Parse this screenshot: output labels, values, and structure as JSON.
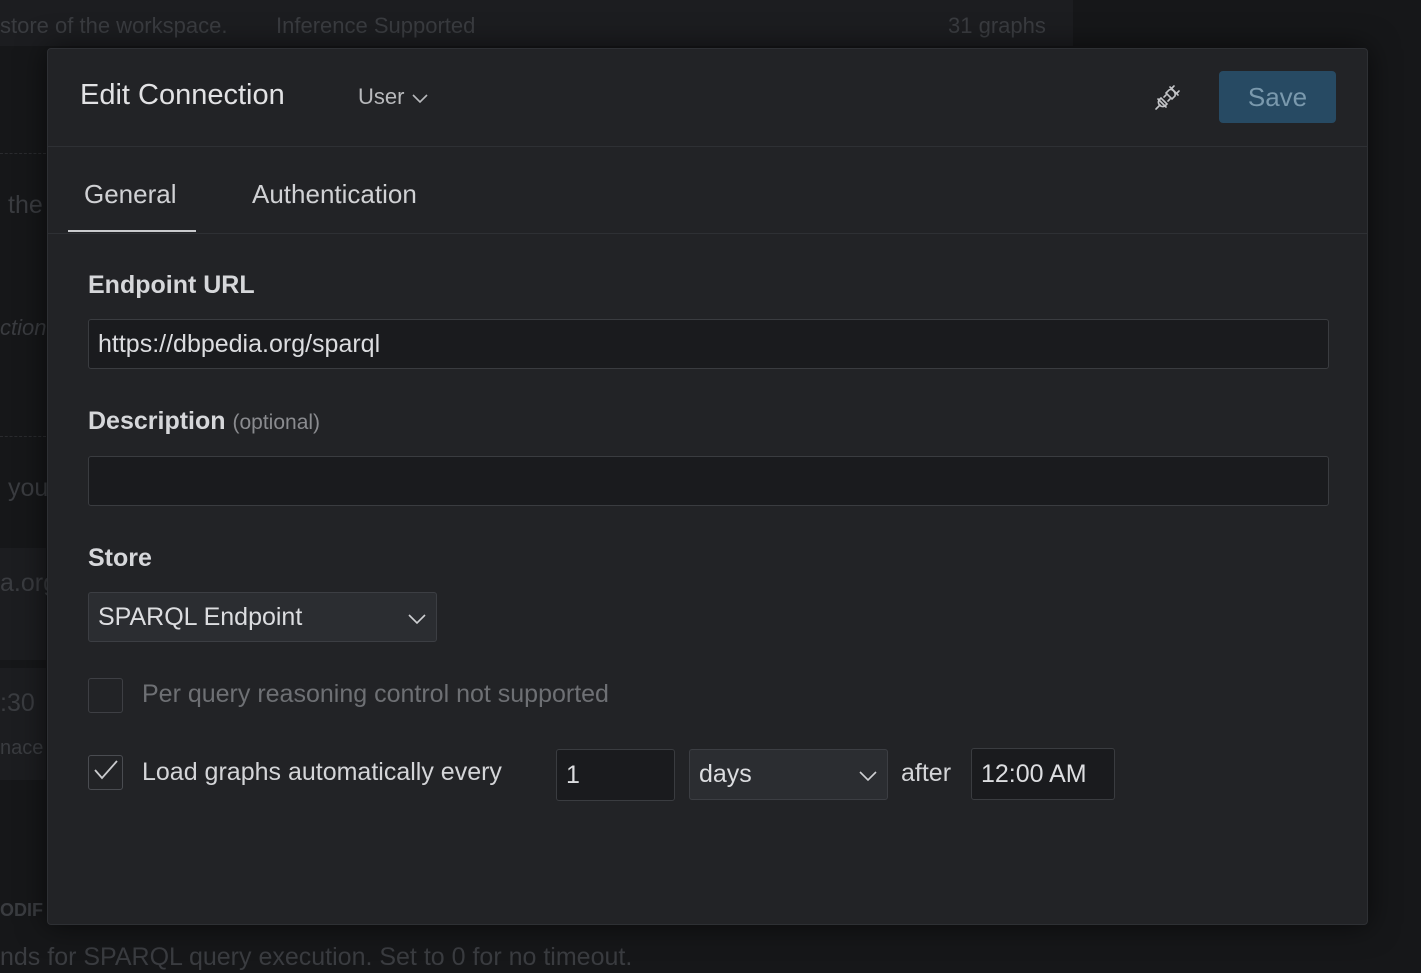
{
  "background": {
    "top_text": "store of the workspace.",
    "top_text2": "Inference Supported",
    "top_count": "31 graphs",
    "side_1": "the",
    "side_2": "ction",
    "side_3": "you",
    "side_4": "a.org",
    "side_5": ":30",
    "side_6": "nace",
    "side_7": "ODIF",
    "bottom_text": "nds for SPARQL query execution. Set to 0 for no timeout."
  },
  "modal": {
    "title": "Edit Connection",
    "scope_select": "User",
    "save_label": "Save"
  },
  "tabs": [
    {
      "label": "General",
      "active": true
    },
    {
      "label": "Authentication",
      "active": false
    }
  ],
  "form": {
    "endpoint_label": "Endpoint URL",
    "endpoint_value": "https://dbpedia.org/sparql",
    "description_label": "Description",
    "description_optional": "(optional)",
    "description_value": "",
    "store_label": "Store",
    "store_value": "SPARQL Endpoint",
    "reasoning_label": "Per query reasoning control not supported",
    "reasoning_checked": false,
    "autoload_label": "Load graphs automatically every",
    "autoload_checked": true,
    "interval_value": "1",
    "interval_unit": "days",
    "after_label": "after",
    "time_value": "12:00 AM"
  },
  "icons": {
    "plug": "plug-disconnect-icon",
    "chevron": "chevron-down-icon",
    "check": "checkmark-icon"
  }
}
